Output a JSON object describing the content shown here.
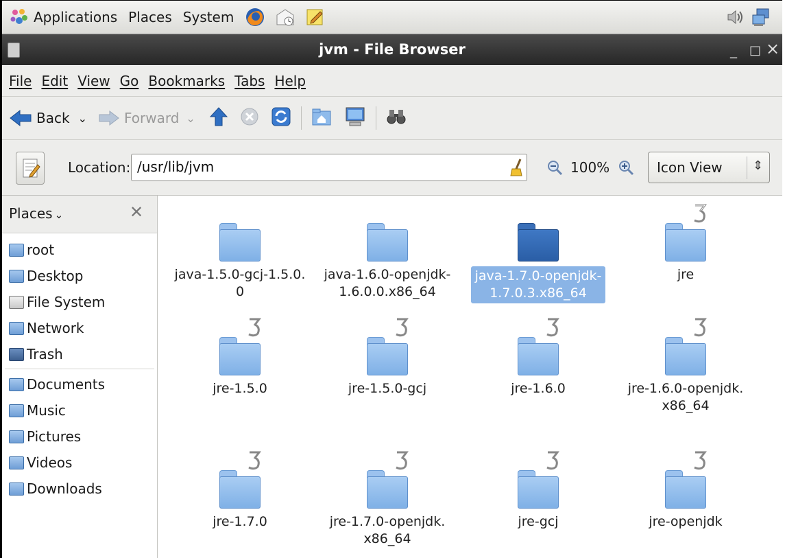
{
  "panel": {
    "menus": [
      "Applications",
      "Places",
      "System"
    ]
  },
  "window": {
    "title": "jvm - File Browser",
    "minimize": "_",
    "maximize": "□",
    "close": "×"
  },
  "menubar": [
    "File",
    "Edit",
    "View",
    "Go",
    "Bookmarks",
    "Tabs",
    "Help"
  ],
  "toolbar": {
    "back": "Back",
    "forward": "Forward"
  },
  "location": {
    "label": "Location:",
    "value": "/usr/lib/jvm",
    "zoom": "100%",
    "view": "Icon View"
  },
  "sidebar": {
    "header": "Places",
    "items": [
      {
        "label": "root",
        "icon": "home-icon"
      },
      {
        "label": "Desktop",
        "icon": "desktop-folder-icon"
      },
      {
        "label": "File System",
        "icon": "harddisk-icon"
      },
      {
        "label": "Network",
        "icon": "network-icon"
      },
      {
        "label": "Trash",
        "icon": "trash-icon"
      },
      {
        "label": "Documents",
        "icon": "documents-folder-icon"
      },
      {
        "label": "Music",
        "icon": "music-folder-icon"
      },
      {
        "label": "Pictures",
        "icon": "pictures-folder-icon"
      },
      {
        "label": "Videos",
        "icon": "videos-folder-icon"
      },
      {
        "label": "Downloads",
        "icon": "downloads-folder-icon"
      }
    ]
  },
  "files": [
    {
      "line1": "java-1.5.0-gcj-1.5.0.",
      "line2": "0",
      "link": false,
      "selected": false
    },
    {
      "line1": "java-1.6.0-openjdk-",
      "line2": "1.6.0.0.x86_64",
      "link": false,
      "selected": false
    },
    {
      "line1": "java-1.7.0-openjdk-",
      "line2": "1.7.0.3.x86_64",
      "link": false,
      "selected": true
    },
    {
      "line1": "jre",
      "line2": "",
      "link": true,
      "selected": false
    },
    {
      "line1": "jre-1.5.0",
      "line2": "",
      "link": true,
      "selected": false
    },
    {
      "line1": "jre-1.5.0-gcj",
      "line2": "",
      "link": true,
      "selected": false
    },
    {
      "line1": "jre-1.6.0",
      "line2": "",
      "link": true,
      "selected": false
    },
    {
      "line1": "jre-1.6.0-openjdk.",
      "line2": "x86_64",
      "link": true,
      "selected": false
    },
    {
      "line1": "jre-1.7.0",
      "line2": "",
      "link": true,
      "selected": false
    },
    {
      "line1": "jre-1.7.0-openjdk.",
      "line2": "x86_64",
      "link": true,
      "selected": false
    },
    {
      "line1": "jre-gcj",
      "line2": "",
      "link": true,
      "selected": false
    },
    {
      "line1": "jre-openjdk",
      "line2": "",
      "link": true,
      "selected": false
    }
  ],
  "colors": {
    "folder": "#8fbbeb",
    "selected_folder": "#2f66b0",
    "selection": "#8ab4e6"
  }
}
